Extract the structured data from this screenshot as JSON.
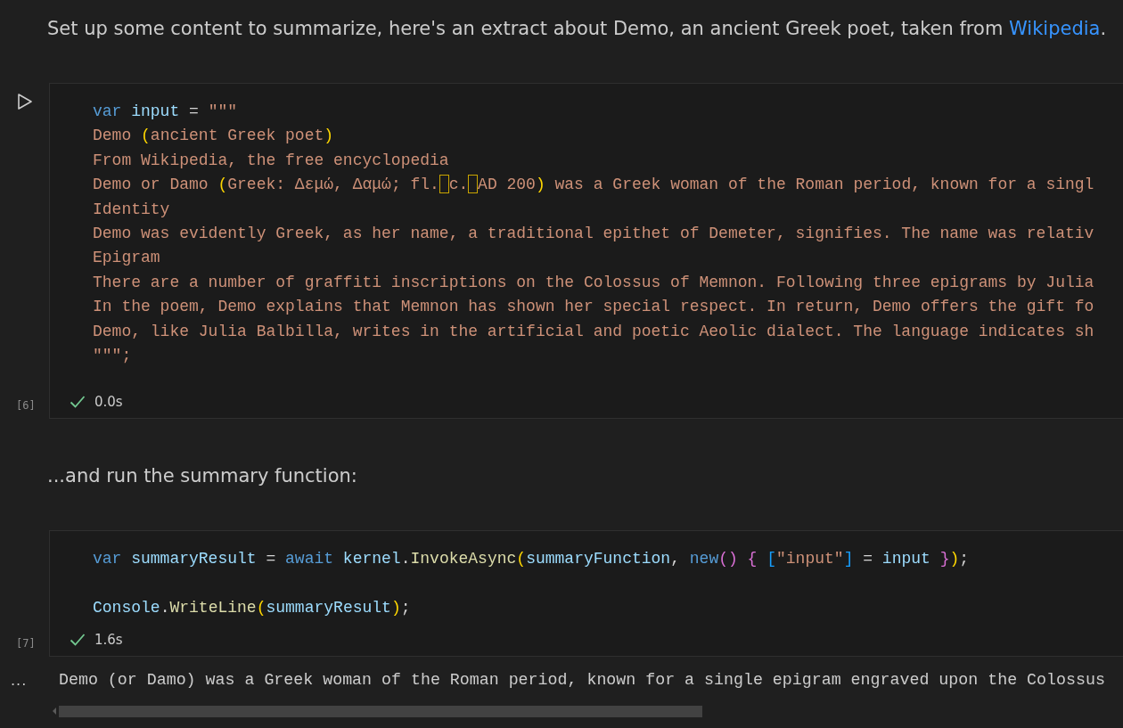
{
  "cells": [
    {
      "kind": "markdown",
      "text_before": "Set up some content to summarize, here's an extract about Demo, an ancient Greek poet, taken from ",
      "link": "Wikipedia",
      "text_after": "."
    },
    {
      "kind": "code",
      "run_button": true,
      "execution_count": "[6]",
      "succeeded": true,
      "duration": "0.0s",
      "lines": [
        {
          "kind": "code",
          "tokens": [
            {
              "kind": "keyword",
              "text": "var"
            },
            {
              "kind": "variable",
              "text": " input"
            },
            {
              "kind": "plain",
              "text": " = "
            },
            {
              "kind": "string",
              "text": "\"\"\""
            }
          ]
        },
        {
          "kind": "code",
          "tokens": [
            {
              "kind": "string",
              "text": "Demo "
            },
            {
              "kind": "bracket1",
              "text": "("
            },
            {
              "kind": "string",
              "text": "ancient Greek poet"
            },
            {
              "kind": "bracket1",
              "text": ")"
            }
          ]
        },
        {
          "kind": "code",
          "tokens": [
            {
              "kind": "string",
              "text": "From Wikipedia, the free encyclopedia"
            }
          ]
        },
        {
          "kind": "code",
          "tokens": [
            {
              "kind": "string",
              "text": "Demo or Damo "
            },
            {
              "kind": "bracket1",
              "text": "("
            },
            {
              "kind": "string",
              "text": "Greek: Δεμώ, Δαμώ; fl."
            },
            {
              "kind": "unusual_space"
            },
            {
              "kind": "string",
              "text": "c."
            },
            {
              "kind": "unusual_space"
            },
            {
              "kind": "string",
              "text": "AD 200"
            },
            {
              "kind": "bracket1",
              "text": ")"
            },
            {
              "kind": "string",
              "text": " was a Greek woman of the Roman period, known for a singl"
            }
          ]
        },
        {
          "kind": "code",
          "tokens": [
            {
              "kind": "string",
              "text": "Identity"
            }
          ]
        },
        {
          "kind": "code",
          "tokens": [
            {
              "kind": "string",
              "text": "Demo was evidently Greek, as her name, a traditional epithet of Demeter, signifies. The name was relativ"
            }
          ]
        },
        {
          "kind": "code",
          "tokens": [
            {
              "kind": "string",
              "text": "Epigram"
            }
          ]
        },
        {
          "kind": "code",
          "tokens": [
            {
              "kind": "string",
              "text": "There are a number of graffiti inscriptions on the Colossus of Memnon. Following three epigrams by Julia"
            }
          ]
        },
        {
          "kind": "code",
          "tokens": [
            {
              "kind": "string",
              "text": "In the poem, Demo explains that Memnon has shown her special respect. In return, Demo offers the gift fo"
            }
          ]
        },
        {
          "kind": "code",
          "tokens": [
            {
              "kind": "string",
              "text": "Demo, like Julia Balbilla, writes in the artificial and poetic Aeolic dialect. The language indicates sh"
            }
          ]
        },
        {
          "kind": "code",
          "tokens": [
            {
              "kind": "string",
              "text": "\"\"\";"
            }
          ]
        }
      ]
    },
    {
      "kind": "markdown",
      "text_before": "...and run the summary function:"
    },
    {
      "kind": "code",
      "execution_count": "[7]",
      "succeeded": true,
      "duration": "1.6s",
      "lines": [
        {
          "kind": "code",
          "tokens": [
            {
              "kind": "keyword",
              "text": "var"
            },
            {
              "kind": "variable",
              "text": " summaryResult"
            },
            {
              "kind": "plain",
              "text": " = "
            },
            {
              "kind": "keyword",
              "text": "await"
            },
            {
              "kind": "variable",
              "text": " kernel"
            },
            {
              "kind": "plain",
              "text": "."
            },
            {
              "kind": "method",
              "text": "InvokeAsync"
            },
            {
              "kind": "bracket1",
              "text": "("
            },
            {
              "kind": "variable",
              "text": "summaryFunction"
            },
            {
              "kind": "plain",
              "text": ", "
            },
            {
              "kind": "keyword",
              "text": "new"
            },
            {
              "kind": "bracket2",
              "text": "()"
            },
            {
              "kind": "bracket2",
              "text": " {"
            },
            {
              "kind": "bracket3",
              "text": " ["
            },
            {
              "kind": "string",
              "text": "\"input\""
            },
            {
              "kind": "bracket3",
              "text": "]"
            },
            {
              "kind": "plain",
              "text": " = "
            },
            {
              "kind": "variable",
              "text": "input"
            },
            {
              "kind": "bracket2",
              "text": " }"
            },
            {
              "kind": "bracket1",
              "text": ")"
            },
            {
              "kind": "plain",
              "text": ";"
            }
          ]
        },
        {
          "kind": "blank"
        },
        {
          "kind": "code",
          "tokens": [
            {
              "kind": "variable",
              "text": "Console"
            },
            {
              "kind": "plain",
              "text": "."
            },
            {
              "kind": "method",
              "text": "WriteLine"
            },
            {
              "kind": "bracket1",
              "text": "("
            },
            {
              "kind": "variable",
              "text": "summaryResult"
            },
            {
              "kind": "bracket1",
              "text": ")"
            },
            {
              "kind": "plain",
              "text": ";"
            }
          ]
        }
      ]
    },
    {
      "kind": "output",
      "menu": "...",
      "text": "Demo (or Damo) was a Greek woman of the Roman period, known for a single epigram engraved upon the Colossus"
    }
  ]
}
